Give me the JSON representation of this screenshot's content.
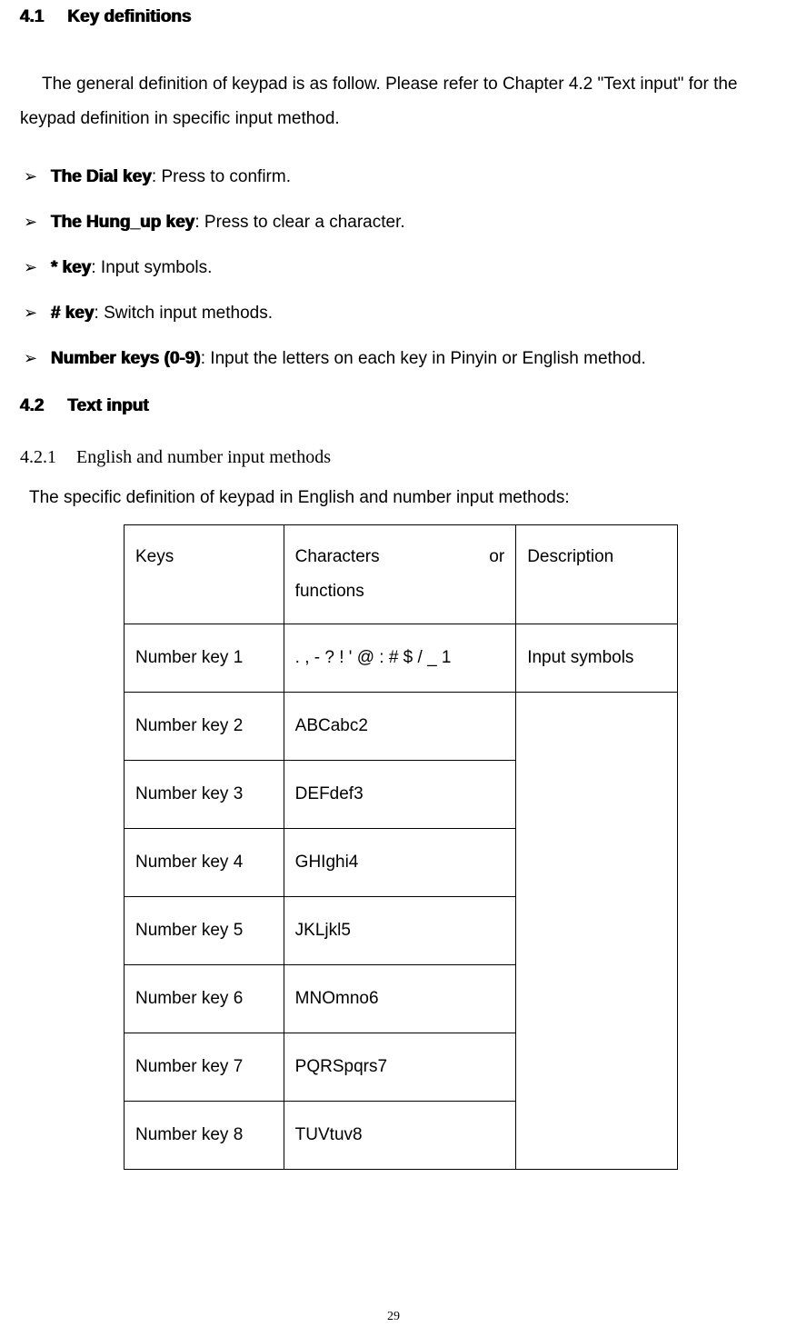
{
  "section41": {
    "number": "4.1",
    "title": "Key definitions",
    "intro": "The general definition of keypad is as follow. Please refer to Chapter 4.2 \"Text input\" for the keypad definition in specific input method.",
    "bullets": [
      {
        "term": "The Dial key",
        "desc": ": Press to confirm."
      },
      {
        "term": "The Hung_up key",
        "desc": ": Press to clear a character."
      },
      {
        "term": "* key",
        "desc": ": Input symbols."
      },
      {
        "term": "# key",
        "desc": ": Switch input methods."
      },
      {
        "term": "Number keys (0-9)",
        "desc": ": Input the letters on each key in Pinyin or English method."
      }
    ]
  },
  "section42": {
    "number": "4.2",
    "title": "Text input",
    "sub": {
      "number": "4.2.1",
      "title": "English and number input methods",
      "intro": "The specific definition of keypad in English and number input methods:"
    }
  },
  "table": {
    "headers": {
      "col1": "Keys",
      "col2a": "Characters",
      "col2b": "or",
      "col2c": "functions",
      "col3": "Description"
    },
    "rows": [
      {
        "key": "Number key 1",
        "chars": ". , - ? ! ' @ : # $ / _ 1",
        "desc": "Input symbols"
      },
      {
        "key": "Number key 2",
        "chars": "ABCabc2"
      },
      {
        "key": "Number key 3",
        "chars": "DEFdef3"
      },
      {
        "key": "Number key 4",
        "chars": "GHIghi4"
      },
      {
        "key": "Number key 5",
        "chars": "JKLjkl5"
      },
      {
        "key": "Number key 6",
        "chars": "MNOmno6"
      },
      {
        "key": "Number key 7",
        "chars": "PQRSpqrs7"
      },
      {
        "key": "Number key 8",
        "chars": "TUVtuv8"
      }
    ]
  },
  "pageNumber": "29"
}
